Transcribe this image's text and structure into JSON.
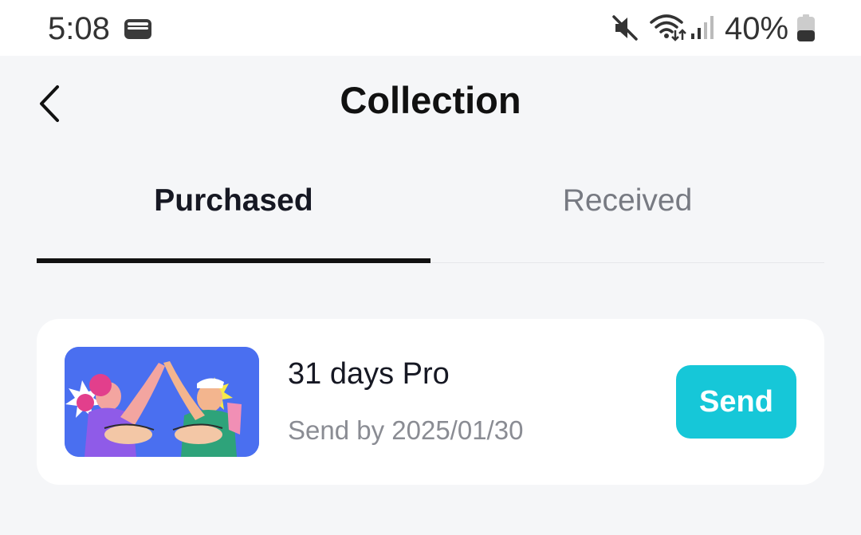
{
  "status_bar": {
    "time": "5:08",
    "battery_text": "40%",
    "icons": [
      "wallet-icon",
      "mute-icon",
      "wifi-icon",
      "signal-icon",
      "battery-icon"
    ]
  },
  "header": {
    "title": "Collection",
    "back_icon": "chevron-left-icon"
  },
  "tabs": [
    {
      "label": "Purchased",
      "active": true
    },
    {
      "label": "Received",
      "active": false
    }
  ],
  "items": [
    {
      "title": "31 days Pro",
      "subtitle": "Send by 2025/01/30",
      "action_label": "Send",
      "thumbnail": "high-five-illustration"
    }
  ],
  "colors": {
    "accent": "#16c7d8",
    "page_background": "#f5f6f8",
    "thumbnail_background": "#4a6ff0"
  }
}
